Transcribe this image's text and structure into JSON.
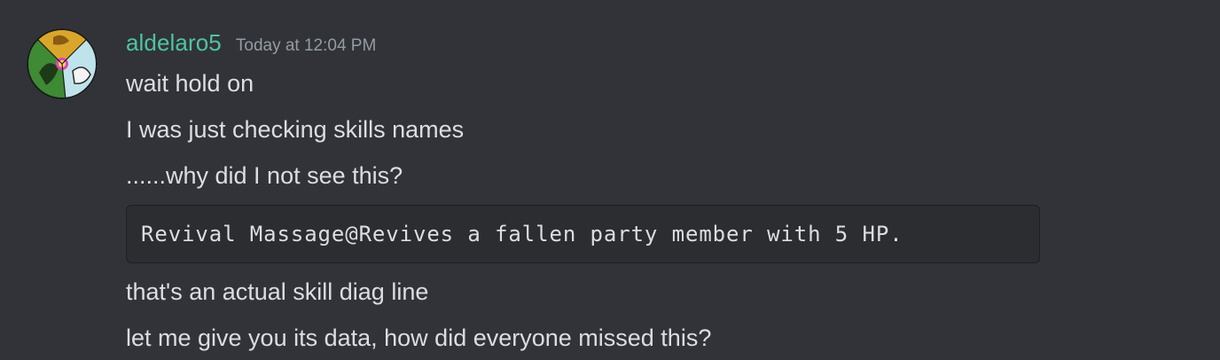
{
  "message": {
    "author": "aldelaro5",
    "timestamp": "Today at 12:04 PM",
    "lines": [
      "wait hold on",
      "I was just checking skills names",
      "......why did I not see this?"
    ],
    "code_block": "Revival Massage@Revives a fallen party member with 5 HP.",
    "lines_after": [
      "that's an actual skill diag line",
      "let me give you its data, how did everyone missed this?"
    ]
  },
  "colors": {
    "background": "#313338",
    "username": "#4fc3a1",
    "timestamp": "#949ba4",
    "text": "#dbdee1",
    "code_background": "#2b2d31"
  },
  "icons": {
    "avatar": "user-avatar"
  }
}
